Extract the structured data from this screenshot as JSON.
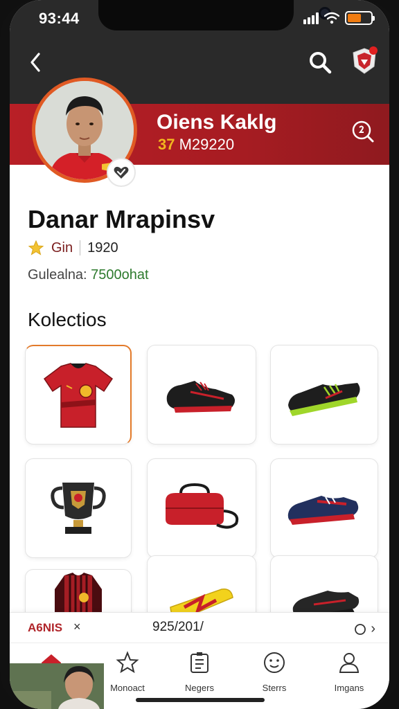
{
  "status": {
    "time": "93:44"
  },
  "header": {
    "banner_name": "Oiens Kaklg",
    "banner_num_a": "37",
    "banner_num_b": " M29220"
  },
  "profile": {
    "name": "Danar Mrapinsv",
    "rating_label": "Gin",
    "rating_value": "1920",
    "value_label": "Gulealna: ",
    "value_amount": "7500ohat"
  },
  "collection": {
    "title": "Kolectios",
    "items": [
      {
        "name": "red-jersey",
        "selected": true
      },
      {
        "name": "black-red-boots",
        "selected": false
      },
      {
        "name": "black-green-boots",
        "selected": false
      },
      {
        "name": "trophy",
        "selected": false
      },
      {
        "name": "red-bag",
        "selected": false
      },
      {
        "name": "blue-red-boots",
        "selected": false
      },
      {
        "name": "long-sleeve-jersey",
        "selected": false
      },
      {
        "name": "yellow-shin-guard",
        "selected": false
      },
      {
        "name": "black-boots",
        "selected": false
      }
    ]
  },
  "bottom_bar": {
    "left_label": "A6NIS",
    "close": "×",
    "middle": "925/201/",
    "right": "›"
  },
  "tabs": [
    {
      "label": "",
      "icon": "home-icon"
    },
    {
      "label": "Monoact",
      "icon": "star-icon"
    },
    {
      "label": "Negers",
      "icon": "board-icon"
    },
    {
      "label": "Sterrs",
      "icon": "smile-icon"
    },
    {
      "label": "Imgans",
      "icon": "person-icon"
    }
  ],
  "colors": {
    "accent": "#b81f26",
    "header": "#2a2a2a",
    "orange": "#e05a24"
  }
}
